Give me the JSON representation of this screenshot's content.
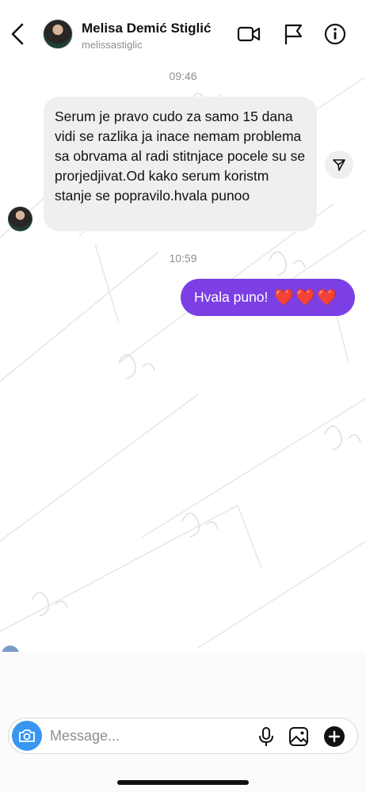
{
  "header": {
    "name": "Melisa Demić Stiglić",
    "username": "melissastiglic",
    "icons": [
      "back-arrow-icon",
      "video-call-icon",
      "flag-icon",
      "info-icon"
    ]
  },
  "conversation": {
    "timestamp_1": "09:46",
    "incoming_message": "Serum je pravo cudo za samo 15 dana vidi se razlika ja inace nemam problema sa obrvama al radi stitnjace pocele su se prorjedjivat.Od kako serum koristm stanje se popravilo.hvala punoo",
    "timestamp_2": "10:59",
    "outgoing_message": "Hvala puno!",
    "outgoing_hearts": "❤️❤️❤️"
  },
  "composer": {
    "placeholder": "Message...",
    "icons": [
      "camera-icon",
      "microphone-icon",
      "gallery-icon",
      "plus-icon"
    ]
  },
  "colors": {
    "accent_blue": "#3797f0",
    "outgoing_bubble": "#7b3fe4",
    "incoming_bubble": "#efefef",
    "heart_red": "#e3263b"
  }
}
